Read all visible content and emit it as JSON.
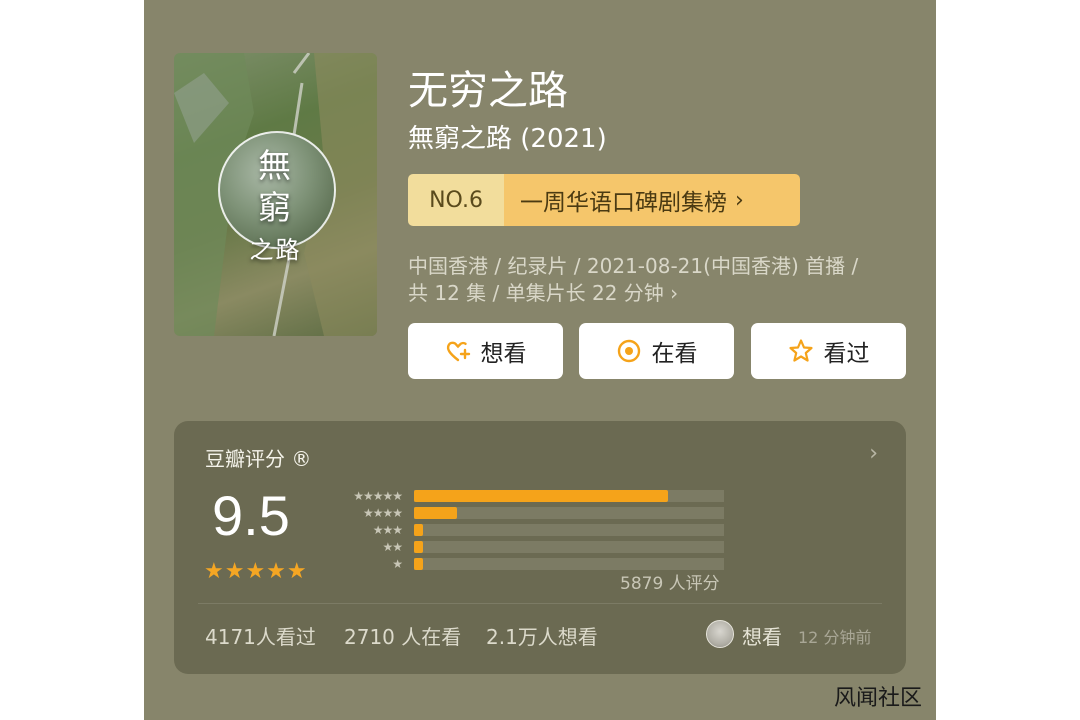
{
  "poster": {
    "title_line1": "無",
    "title_line2": "窮",
    "title_line3": "之路"
  },
  "title": "无穷之路",
  "subtitle": "無窮之路 (2021)",
  "ranking": {
    "number": "NO.6",
    "list": "一周华语口碑剧集榜"
  },
  "meta": {
    "line1": "中国香港 / 纪录片 / 2021-08-21(中国香港) 首播 /",
    "line2": "共 12 集 / 单集片长 22 分钟"
  },
  "actions": [
    {
      "label": "想看",
      "icon": "heart-plus-icon"
    },
    {
      "label": "在看",
      "icon": "target-icon"
    },
    {
      "label": "看过",
      "icon": "star-outline-icon"
    }
  ],
  "rating": {
    "title": "豆瓣评分 ®",
    "score": "9.5",
    "stars": "★★★★★",
    "distribution": [
      {
        "label": "★★★★★",
        "fraction": 0.82
      },
      {
        "label": "★★★★",
        "fraction": 0.14
      },
      {
        "label": "★★★",
        "fraction": 0.03
      },
      {
        "label": "★★",
        "fraction": 0.02
      },
      {
        "label": "★",
        "fraction": 0.02
      }
    ],
    "count": "5879 人评分"
  },
  "stats": {
    "watched": "4171人看过",
    "watching": "2710 人在看",
    "want": "2.1万人想看"
  },
  "friend": {
    "status": "想看",
    "time": "12 分钟前"
  },
  "colors": {
    "background": "#87856b",
    "card": "#6b6a52",
    "accent": "#f5a31a",
    "rank_bg": "#f5c66b"
  },
  "watermark": "风闻社区"
}
